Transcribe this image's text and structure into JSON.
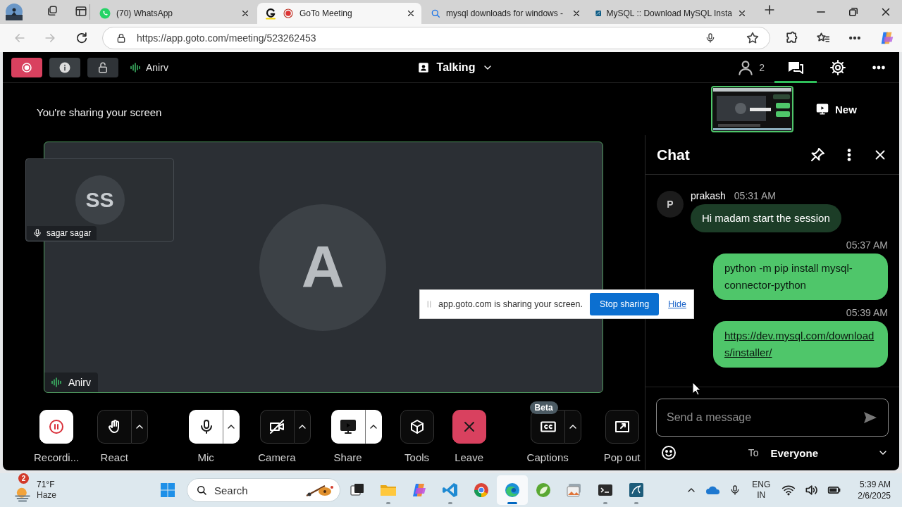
{
  "browser": {
    "tabs": [
      {
        "title": "(70) WhatsApp",
        "kind": "whatsapp",
        "recording": false,
        "selected": false
      },
      {
        "title": "GoTo Meeting",
        "kind": "goto",
        "recording": true,
        "selected": true
      },
      {
        "title": "mysql downloads for windows -",
        "kind": "search",
        "recording": false,
        "selected": false
      },
      {
        "title": "MySQL :: Download MySQL Insta",
        "kind": "mysql",
        "recording": false,
        "selected": false
      }
    ],
    "address": "https://app.goto.com/meeting/523262453"
  },
  "meeting": {
    "top_bar": {
      "speaker": "Anirv",
      "view": "Talking",
      "participants": "2",
      "chat_open": true
    },
    "sharing_notice": "You're sharing your screen",
    "new_button": "New",
    "self_tile": {
      "initials": "SS",
      "name": "sagar sagar"
    },
    "main_tile": {
      "initial": "A",
      "name": "Anirv"
    },
    "share_banner": {
      "text": "app.goto.com is sharing your screen.",
      "stop_button": "Stop sharing",
      "hide_link": "Hide"
    },
    "control_groups": [
      [
        {
          "kind": "record",
          "label": "Recordi...",
          "active": true,
          "menu": false
        },
        {
          "kind": "react",
          "label": "React",
          "active": false,
          "menu": true
        }
      ],
      [
        {
          "kind": "mic",
          "label": "Mic",
          "active": true,
          "menu": true
        },
        {
          "kind": "camera",
          "label": "Camera",
          "active": false,
          "menu": true
        },
        {
          "kind": "share",
          "label": "Share",
          "active": true,
          "menu": true
        },
        {
          "kind": "tools",
          "label": "Tools",
          "active": false,
          "menu": false
        },
        {
          "kind": "leave",
          "label": "Leave"
        }
      ],
      [
        {
          "kind": "captions",
          "label": "Captions",
          "badge": "Beta",
          "active": false,
          "menu": true
        },
        {
          "kind": "popout",
          "label": "Pop out",
          "active": false,
          "menu": false
        }
      ]
    ],
    "chat": {
      "title": "Chat",
      "messages": [
        {
          "kind": "received",
          "avatar": "P",
          "sender": "prakash",
          "time": "05:31 AM",
          "text": "Hi madam start the session",
          "link": false
        },
        {
          "kind": "sent",
          "time": "05:37 AM",
          "text": "python -m pip install mysql-connector-python",
          "link": false
        },
        {
          "kind": "sent",
          "time": "05:39 AM",
          "text": "https://dev.mysql.com/downloads/installer/",
          "link": true
        }
      ],
      "composer": {
        "placeholder": "Send a message",
        "to_label": "To",
        "recipient": "Everyone"
      }
    }
  },
  "taskbar": {
    "weather": {
      "badge": "2",
      "temperature": "71°F",
      "condition": "Haze"
    },
    "search": {
      "placeholder": "Search"
    },
    "apps": [
      {
        "kind": "taskview",
        "running": false,
        "selected": false
      },
      {
        "kind": "folder",
        "running": true,
        "selected": false
      },
      {
        "kind": "copilot",
        "running": false,
        "selected": false
      },
      {
        "kind": "vscode",
        "running": true,
        "selected": false
      },
      {
        "kind": "chrome",
        "running": false,
        "selected": false
      },
      {
        "kind": "edge",
        "running": true,
        "selected": true
      },
      {
        "kind": "leaf",
        "running": false,
        "selected": false
      },
      {
        "kind": "gallery",
        "running": false,
        "selected": false
      },
      {
        "kind": "terminal",
        "running": true,
        "selected": false
      },
      {
        "kind": "workbench",
        "running": true,
        "selected": false
      }
    ],
    "tray": {
      "language": "ENG",
      "region": "IN",
      "time": "5:39 AM",
      "date": "2/6/2025"
    }
  }
}
